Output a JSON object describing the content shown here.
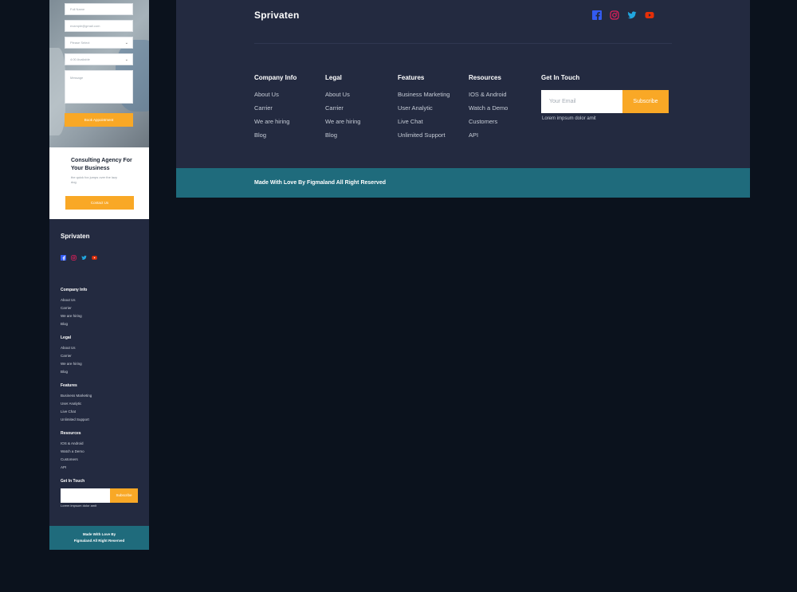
{
  "mobile": {
    "form": {
      "full_name_placeholder": "Full Name",
      "email_placeholder": "example@gmail.com",
      "select_placeholder": "Please Select",
      "time_placeholder": "4:00 Available",
      "message_placeholder": "Message",
      "submit_label": "Book Appointment"
    },
    "consult": {
      "title": "Consulting Agency For Your Business",
      "text": "the quick fox jumps over the lazy dog",
      "button_label": "Contact Us"
    },
    "footer": {
      "brand": "Sprivaten",
      "sections": [
        {
          "heading": "Company Info",
          "links": [
            "About Us",
            "Carrier",
            "We are hiring",
            "Blog"
          ]
        },
        {
          "heading": "Legal",
          "links": [
            "About Us",
            "Carrier",
            "We are hiring",
            "Blog"
          ]
        },
        {
          "heading": "Features",
          "links": [
            "Business Marketing",
            "User Analytic",
            "Live Chat",
            "Unlimited Support"
          ]
        },
        {
          "heading": "Resources",
          "links": [
            "IOS & Android",
            "Watch a Demo",
            "Customers",
            "API"
          ]
        }
      ],
      "get_in_touch": "Get In Touch",
      "subscribe_label": "Subscribe",
      "lorem": "Lorem impsum dolor amit",
      "bottom_line1": "Made With Love By",
      "bottom_line2": "Figmaland All Right Reserved"
    }
  },
  "desktop": {
    "brand": "Sprivaten",
    "social_icons": [
      "facebook-icon",
      "instagram-icon",
      "twitter-icon",
      "youtube-icon"
    ],
    "columns": [
      {
        "heading": "Company Info",
        "links": [
          "About Us",
          "Carrier",
          "We are hiring",
          "Blog"
        ]
      },
      {
        "heading": "Legal",
        "links": [
          "About Us",
          "Carrier",
          "We are hiring",
          "Blog"
        ]
      },
      {
        "heading": "Features",
        "links": [
          "Business Marketing",
          "User Analytic",
          "Live Chat",
          "Unlimited Support"
        ]
      },
      {
        "heading": "Resources",
        "links": [
          "IOS & Android",
          "Watch a Demo",
          "Customers",
          "API"
        ]
      }
    ],
    "get_in_touch": "Get In Touch",
    "email_placeholder": "Your Email",
    "subscribe_label": "Subscribe",
    "lorem": "Lorem impsum dolor amit",
    "copyright": "Made With Love By Figmaland All Right Reserved"
  },
  "colors": {
    "background": "#0b121d",
    "footer": "#232a40",
    "accent": "#f9a826",
    "bottom_bar": "#1f6b7c",
    "facebook": "#335bf1",
    "instagram": "#e51f5a",
    "twitter": "#21a6df",
    "youtube": "#e42f08"
  }
}
